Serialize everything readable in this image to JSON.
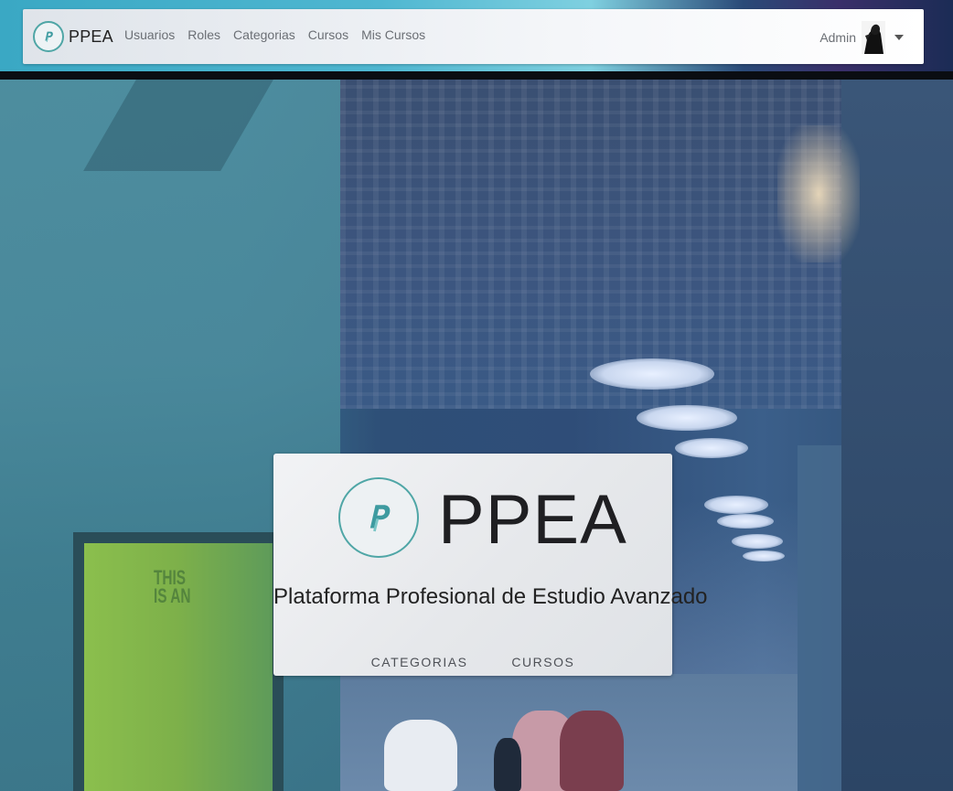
{
  "navbar": {
    "brand": "PPEA",
    "links": [
      "Usuarios",
      "Roles",
      "Categorias",
      "Cursos",
      "Mis Cursos"
    ],
    "user": "Admin"
  },
  "hero": {
    "title": "PPEA",
    "subtitle": "Plataforma Profesional de Estudio Avanzado",
    "actions": [
      "CATEGORIAS",
      "CURSOS"
    ],
    "poster_text": [
      "THIS",
      "IS AN"
    ]
  },
  "colors": {
    "accent_logo": "#4fa6a6",
    "nav_text": "#6b6f75"
  }
}
